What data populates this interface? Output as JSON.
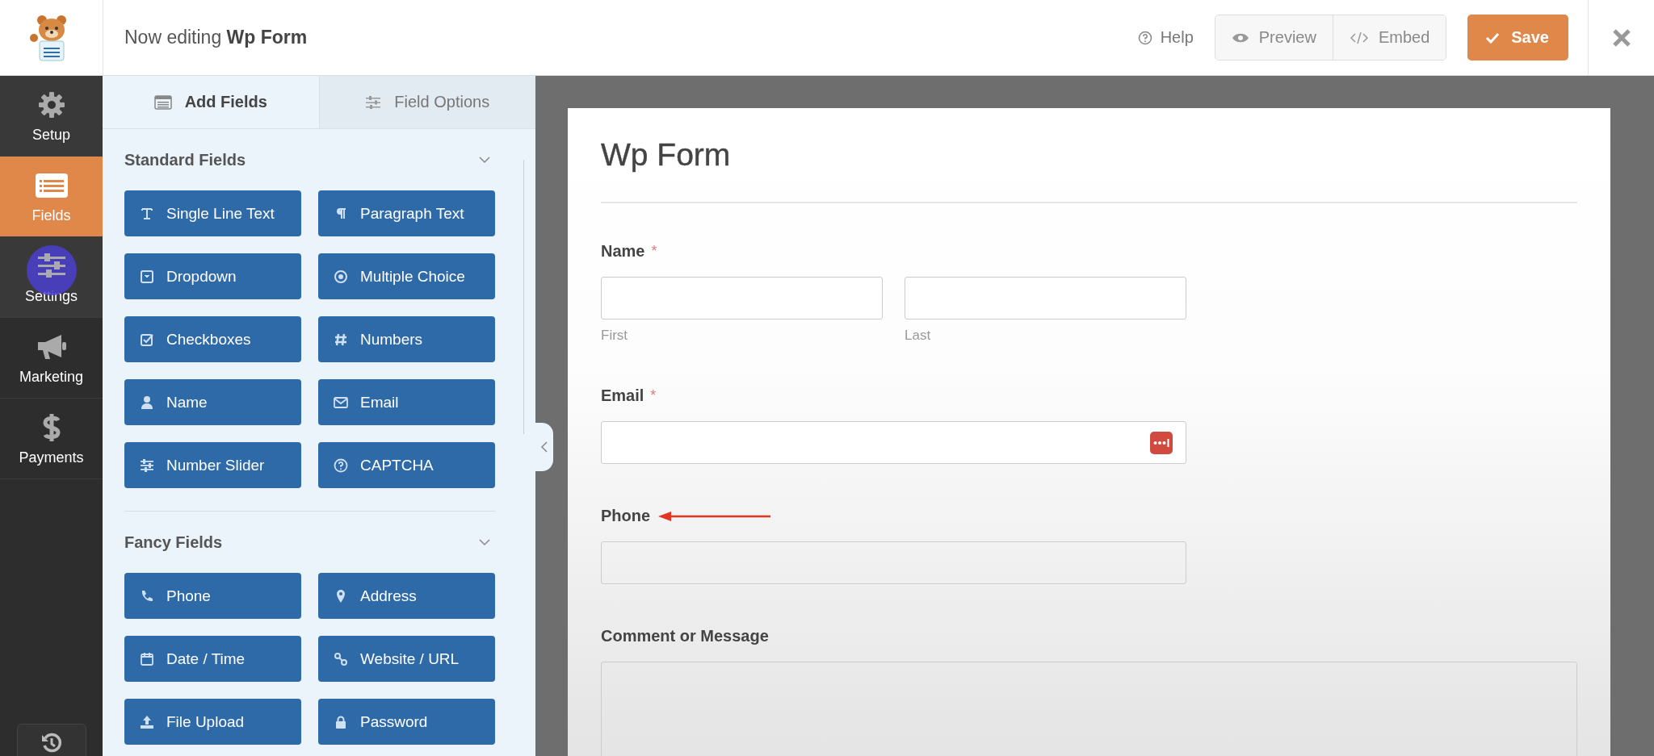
{
  "header": {
    "title_prefix": "Now editing",
    "form_name": "Wp Form",
    "help": "Help",
    "preview": "Preview",
    "embed": "Embed",
    "save": "Save"
  },
  "nav": [
    {
      "label": "Setup",
      "selected": false
    },
    {
      "label": "Fields",
      "selected": true
    },
    {
      "label": "Settings",
      "selected": false
    },
    {
      "label": "Marketing",
      "selected": false
    },
    {
      "label": "Payments",
      "selected": false
    }
  ],
  "panel_tabs": [
    {
      "label": "Add Fields",
      "selected": true
    },
    {
      "label": "Field Options",
      "selected": false
    }
  ],
  "groups": [
    {
      "title": "Standard Fields",
      "expanded": true,
      "fields": [
        "Single Line Text",
        "Paragraph Text",
        "Dropdown",
        "Multiple Choice",
        "Checkboxes",
        "Numbers",
        "Name",
        "Email",
        "Number Slider",
        "CAPTCHA"
      ]
    },
    {
      "title": "Fancy Fields",
      "expanded": true,
      "fields": [
        "Phone",
        "Address",
        "Date / Time",
        "Website / URL",
        "File Upload",
        "Password"
      ]
    }
  ],
  "form": {
    "title": "Wp Form",
    "fields": [
      {
        "kind": "name",
        "label": "Name",
        "required_mark": "*",
        "sublabels": [
          "First",
          "Last"
        ],
        "annotated": false
      },
      {
        "kind": "email",
        "label": "Email",
        "required_mark": "*",
        "annotated": false
      },
      {
        "kind": "text",
        "label": "Phone",
        "annotated": true
      },
      {
        "kind": "textarea",
        "label": "Comment or Message",
        "annotated": false
      }
    ]
  }
}
